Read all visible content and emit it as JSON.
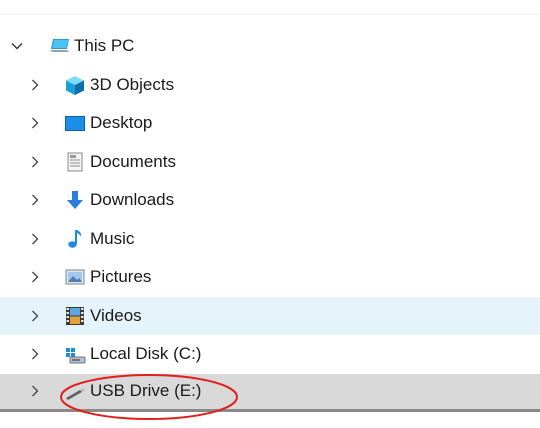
{
  "tree": {
    "root": {
      "label": "This PC",
      "icon": "this-pc-icon",
      "expanded": true
    },
    "items": [
      {
        "label": "3D Objects",
        "icon": "3d-objects-icon"
      },
      {
        "label": "Desktop",
        "icon": "desktop-icon"
      },
      {
        "label": "Documents",
        "icon": "documents-icon"
      },
      {
        "label": "Downloads",
        "icon": "downloads-icon"
      },
      {
        "label": "Music",
        "icon": "music-icon"
      },
      {
        "label": "Pictures",
        "icon": "pictures-icon"
      },
      {
        "label": "Videos",
        "icon": "videos-icon",
        "state": "hover"
      },
      {
        "label": "Local Disk (C:)",
        "icon": "local-disk-icon"
      },
      {
        "label": "USB Drive (E:)",
        "icon": "usb-drive-icon",
        "state": "selected"
      }
    ]
  },
  "colors": {
    "hover_row": "#e5f3fb",
    "selected_row": "#d9d9d9",
    "annotation_circle": "#e0201c"
  }
}
